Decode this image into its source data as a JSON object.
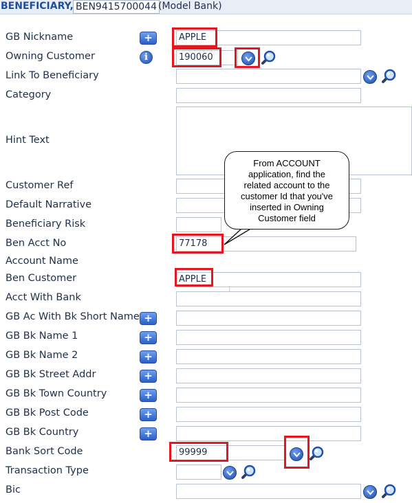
{
  "header": {
    "title": "BENEFICIARY,",
    "record_id": "BEN9415700044",
    "bank": "(Model Bank)"
  },
  "fields": {
    "gb_nickname": {
      "label": "GB Nickname",
      "value": "APPLE"
    },
    "owning_customer": {
      "label": "Owning Customer",
      "value": "190060"
    },
    "link_to_beneficiary": {
      "label": "Link To Beneficiary",
      "value": ""
    },
    "category": {
      "label": "Category",
      "value": ""
    },
    "hint_text": {
      "label": "Hint Text",
      "value": ""
    },
    "customer_ref": {
      "label": "Customer Ref",
      "value": ""
    },
    "default_narrative": {
      "label": "Default Narrative",
      "value": ""
    },
    "beneficiary_risk": {
      "label": "Beneficiary Risk",
      "value": ""
    },
    "ben_acct_no": {
      "label": "Ben Acct No",
      "value": "77178"
    },
    "account_name": {
      "label": "Account Name"
    },
    "ben_customer": {
      "label": "Ben Customer",
      "value": "APPLE"
    },
    "acct_with_bank": {
      "label": "Acct With Bank",
      "value": ""
    },
    "gb_ac_with_bk_short_name": {
      "label": "GB Ac With Bk Short Name",
      "value": ""
    },
    "gb_bk_name_1": {
      "label": "GB Bk Name 1",
      "value": ""
    },
    "gb_bk_name_2": {
      "label": "GB Bk Name 2",
      "value": ""
    },
    "gb_bk_street_addr": {
      "label": "GB Bk Street Addr",
      "value": ""
    },
    "gb_bk_town_country": {
      "label": "GB Bk Town Country",
      "value": ""
    },
    "gb_bk_post_code": {
      "label": "GB Bk Post Code",
      "value": ""
    },
    "gb_bk_country": {
      "label": "GB Bk Country",
      "value": ""
    },
    "bank_sort_code": {
      "label": "Bank Sort Code",
      "value": "99999"
    },
    "transaction_type": {
      "label": "Transaction Type",
      "value": ""
    },
    "bic": {
      "label": "Bic",
      "value": ""
    }
  },
  "icons": {
    "expand": "plus-icon",
    "info": "info-icon",
    "dropdown": "chevron-down-icon",
    "lookup": "magnifier-icon"
  },
  "callout": {
    "text": "From ACCOUNT\napplication, find the\nrelated account to the\ncustomer Id that you've\ninserted in Owning\nCustomer field"
  },
  "colors": {
    "highlight": "#e5161d",
    "header_text": "#1d4f9c",
    "button_blue": "#2b5fc7"
  }
}
